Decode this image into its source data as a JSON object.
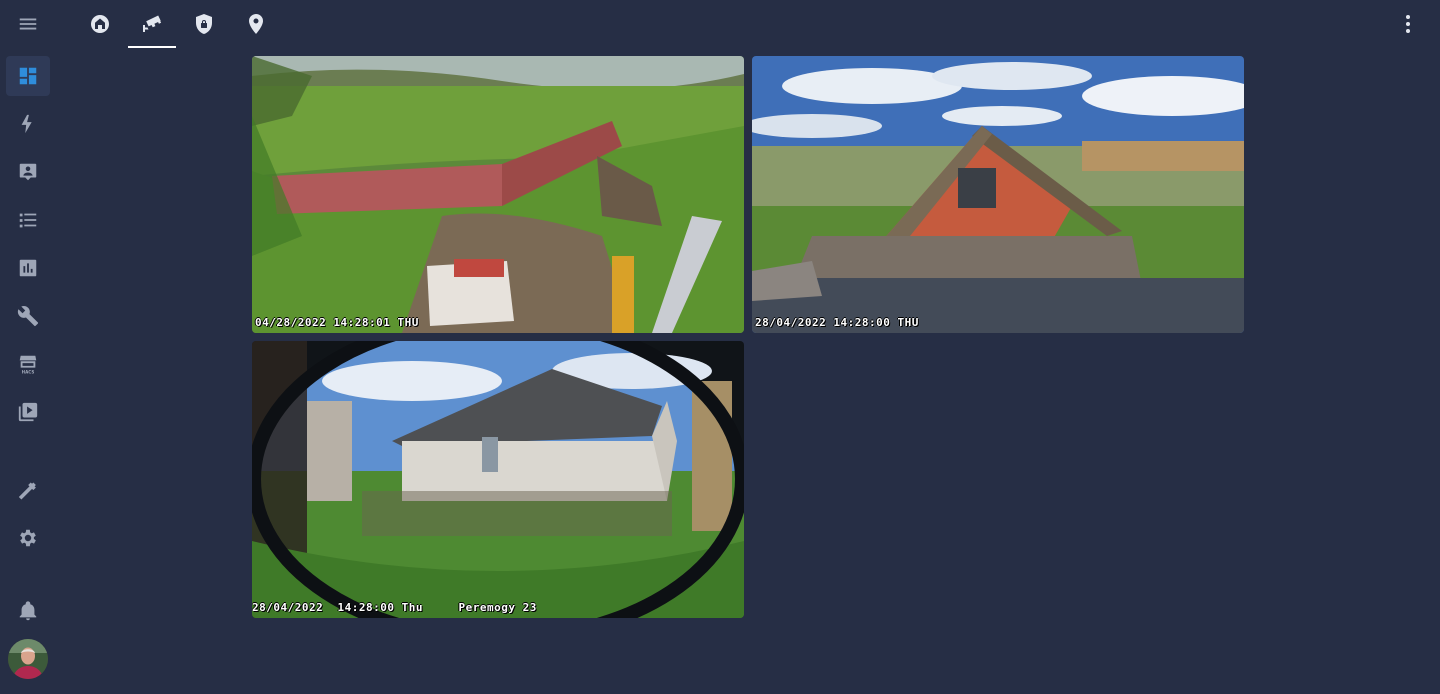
{
  "sidebar": {
    "items": [
      {
        "name": "menu-icon"
      },
      {
        "name": "dashboard-icon",
        "active": true
      },
      {
        "name": "energy-icon"
      },
      {
        "name": "logbook-icon"
      },
      {
        "name": "list-icon"
      },
      {
        "name": "history-icon"
      },
      {
        "name": "wrench-icon"
      },
      {
        "name": "hacs-icon",
        "label": "HACS"
      },
      {
        "name": "media-icon"
      },
      {
        "name": "developer-tools-icon"
      },
      {
        "name": "settings-icon"
      },
      {
        "name": "notifications-icon"
      }
    ]
  },
  "tabs": [
    {
      "name": "home-icon"
    },
    {
      "name": "cctv-icon",
      "active": true
    },
    {
      "name": "security-icon"
    },
    {
      "name": "map-marker-icon"
    }
  ],
  "colors": {
    "background": "#262e45",
    "accent": "#2f8ddb",
    "icon": "#9ea6b7"
  },
  "cameras": [
    {
      "timestamp": "04/28/2022 14:28:01 THU"
    },
    {
      "timestamp": "28/04/2022 14:28:00 THU"
    },
    {
      "timestamp": "28/04/2022  14:28:00 Thu     Peremogy 23"
    }
  ]
}
